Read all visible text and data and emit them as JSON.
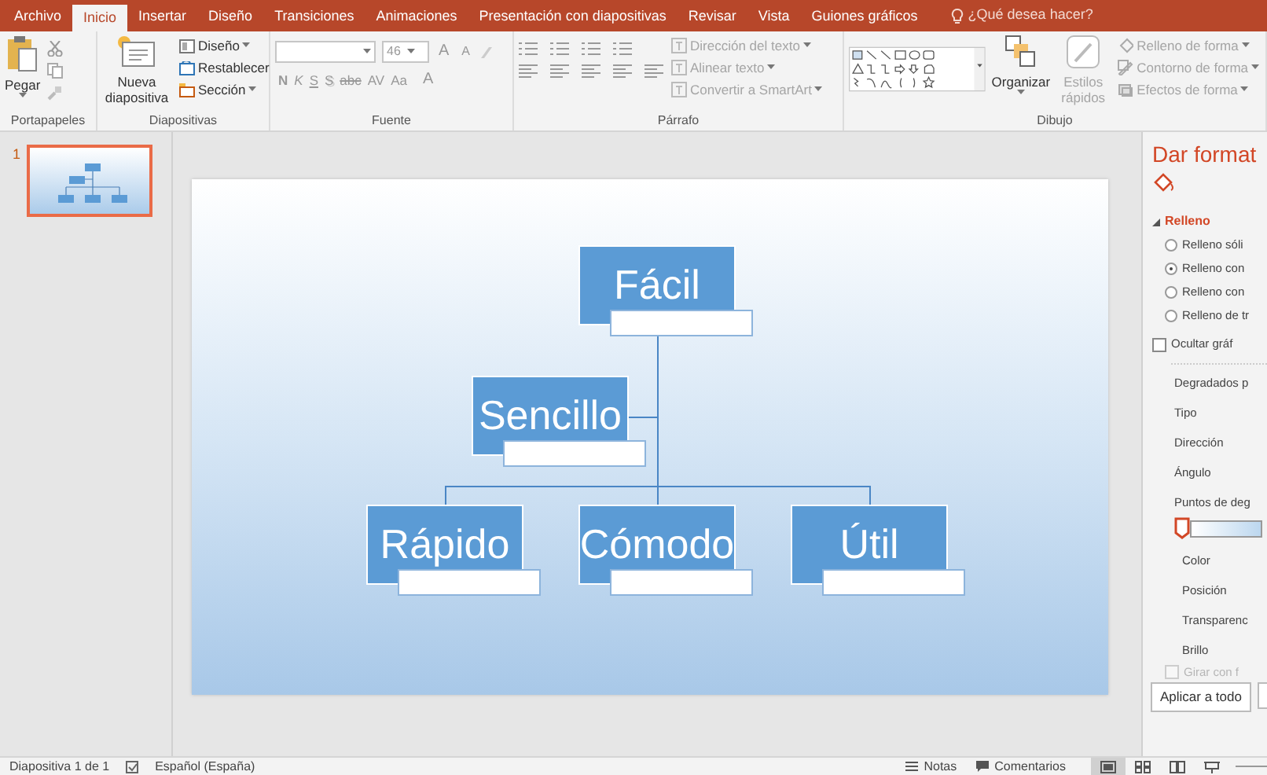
{
  "tabs": [
    {
      "label": "Archivo",
      "selected": false
    },
    {
      "label": "Inicio",
      "selected": true
    },
    {
      "label": "Insertar",
      "selected": false
    },
    {
      "label": "Diseño",
      "selected": false
    },
    {
      "label": "Transiciones",
      "selected": false
    },
    {
      "label": "Animaciones",
      "selected": false
    },
    {
      "label": "Presentación con diapositivas",
      "selected": false
    },
    {
      "label": "Revisar",
      "selected": false
    },
    {
      "label": "Vista",
      "selected": false
    },
    {
      "label": "Guiones gráficos",
      "selected": false
    }
  ],
  "tell_me": {
    "placeholder": "¿Qué desea hacer?"
  },
  "ribbon": {
    "groups": [
      {
        "kind": "clipboard",
        "label": "Portapapeles",
        "paste": "Pegar"
      },
      {
        "kind": "slides",
        "label": "Diapositivas",
        "new_slide": "Nueva diapositiva",
        "items": [
          {
            "label": "Diseño",
            "dropdown": true
          },
          {
            "label": "Restablecer",
            "dropdown": false
          },
          {
            "label": "Sección",
            "dropdown": true
          }
        ]
      },
      {
        "kind": "font",
        "label": "Fuente",
        "font_size": "46",
        "size_buttons": [
          "A",
          "A"
        ],
        "format_buttons": [
          "N",
          "K",
          "S",
          "S",
          "abc",
          "AV",
          "Aa"
        ],
        "color_button": "A"
      },
      {
        "kind": "paragraph",
        "label": "Párrafo",
        "items": [
          {
            "label": "Dirección del texto",
            "disabled": true
          },
          {
            "label": "Alinear texto",
            "disabled": true
          },
          {
            "label": "Convertir a SmartArt",
            "disabled": true
          }
        ]
      },
      {
        "kind": "drawing",
        "label": "Dibujo",
        "arrange": "Organizar",
        "quick_styles": {
          "label": "Estilos rápidos",
          "disabled": true
        },
        "items": [
          {
            "label": "Relleno de forma",
            "disabled": true
          },
          {
            "label": "Contorno de forma",
            "disabled": true
          },
          {
            "label": "Efectos de forma",
            "disabled": true
          }
        ]
      }
    ]
  },
  "thumbnails": [
    {
      "number": "1",
      "selected": true
    }
  ],
  "diagram": {
    "nodes": [
      {
        "text": "Fácil",
        "children": [
          {
            "text": "Sencillo",
            "kind": "assistant"
          },
          {
            "text": "Rápido",
            "kind": "child"
          },
          {
            "text": "Cómodo",
            "kind": "child"
          },
          {
            "text": "Útil",
            "kind": "child"
          }
        ]
      }
    ]
  },
  "format_pane": {
    "title": "Dar format",
    "section": {
      "label": "Relleno",
      "expanded": true
    },
    "fill_options": [
      {
        "label": "Relleno sóli",
        "selected": false
      },
      {
        "label": "Relleno con",
        "selected": true
      },
      {
        "label": "Relleno con",
        "selected": false
      },
      {
        "label": "Relleno de tr",
        "selected": false
      }
    ],
    "hide_option": {
      "label": "Ocultar gráf",
      "checked": false
    },
    "properties": [
      "Degradados p",
      "Tipo",
      "Dirección",
      "Ángulo",
      "Puntos de deg"
    ],
    "stop_properties": [
      "Color",
      "Posición",
      "Transparenc",
      "Brillo"
    ],
    "faded_option": {
      "label": "Girar con f",
      "disabled": true,
      "checked": false
    },
    "buttons": [
      "Aplicar a todo"
    ]
  },
  "status_bar": {
    "slide_info": "Diapositiva 1 de 1",
    "language": "Español (España)",
    "notes": "Notas",
    "comments": "Comentarios",
    "views": [
      {
        "kind": "normal",
        "selected": true
      },
      {
        "kind": "sorter",
        "selected": false
      },
      {
        "kind": "reading",
        "selected": false
      },
      {
        "kind": "presenter",
        "selected": false
      }
    ]
  }
}
